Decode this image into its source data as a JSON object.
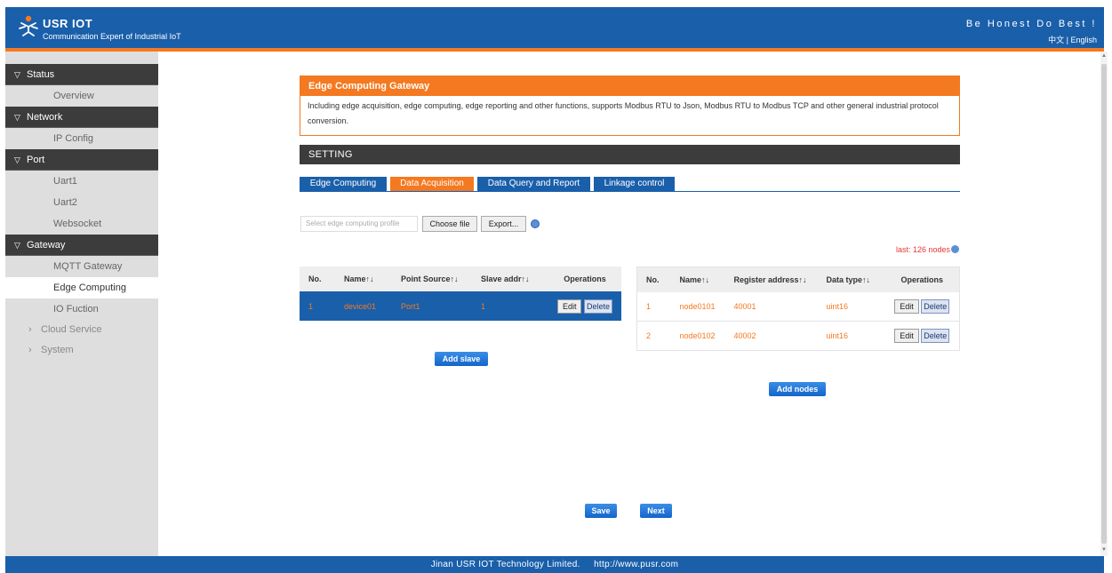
{
  "header": {
    "brand_name": "USR IOT",
    "brand_sub": "Communication Expert of Industrial IoT",
    "slogan": "Be Honest Do Best !",
    "language": "中文 | English"
  },
  "sidebar": {
    "groups": [
      {
        "label": "Status",
        "items": [
          "Overview"
        ]
      },
      {
        "label": "Network",
        "items": [
          "IP Config"
        ]
      },
      {
        "label": "Port",
        "items": [
          "Uart1",
          "Uart2",
          "Websocket"
        ]
      },
      {
        "label": "Gateway",
        "items": [
          "MQTT Gateway",
          "Edge Computing",
          "IO Fuction"
        ]
      }
    ],
    "collapsed": [
      "Cloud Service",
      "System"
    ],
    "active": "Edge Computing"
  },
  "description": {
    "title": "Edge Computing Gateway",
    "body": "Including edge acquisition, edge computing, edge reporting and other functions, supports Modbus RTU to Json, Modbus RTU to Modbus TCP and other general industrial protocol conversion."
  },
  "setting": {
    "title": "SETTING"
  },
  "tabs": [
    {
      "label": "Edge Computing",
      "active": false
    },
    {
      "label": "Data Acquisition",
      "active": true
    },
    {
      "label": "Data Query and Report",
      "active": false
    },
    {
      "label": "Linkage control",
      "active": false
    }
  ],
  "file": {
    "placeholder": "Select edge computing profile",
    "choose_label": "Choose file",
    "export_label": "Export..."
  },
  "last_nodes": "last: 126 nodes",
  "slave_table": {
    "headers": [
      "No.",
      "Name↑↓",
      "Point Source↑↓",
      "Slave addr↑↓",
      "Operations"
    ],
    "rows": [
      {
        "no": "1",
        "name": "device01",
        "source": "Port1",
        "addr": "1"
      }
    ],
    "add_label": "Add slave"
  },
  "node_table": {
    "headers": [
      "No.",
      "Name↑↓",
      "Register address↑↓",
      "Data type↑↓",
      "Operations"
    ],
    "rows": [
      {
        "no": "1",
        "name": "node0101",
        "reg": "40001",
        "type": "uint16"
      },
      {
        "no": "2",
        "name": "node0102",
        "reg": "40002",
        "type": "uint16"
      }
    ],
    "add_label": "Add nodes"
  },
  "ops": {
    "edit_label": "Edit",
    "delete_label": "Delete"
  },
  "actions": {
    "save_label": "Save",
    "next_label": "Next"
  },
  "footer": {
    "text": "Jinan USR IOT Technology Limited.     http://www.pusr.com"
  },
  "colors": {
    "brand_blue": "#1a5faa",
    "accent_orange": "#f47920",
    "dark_bar": "#3c3c3c"
  }
}
